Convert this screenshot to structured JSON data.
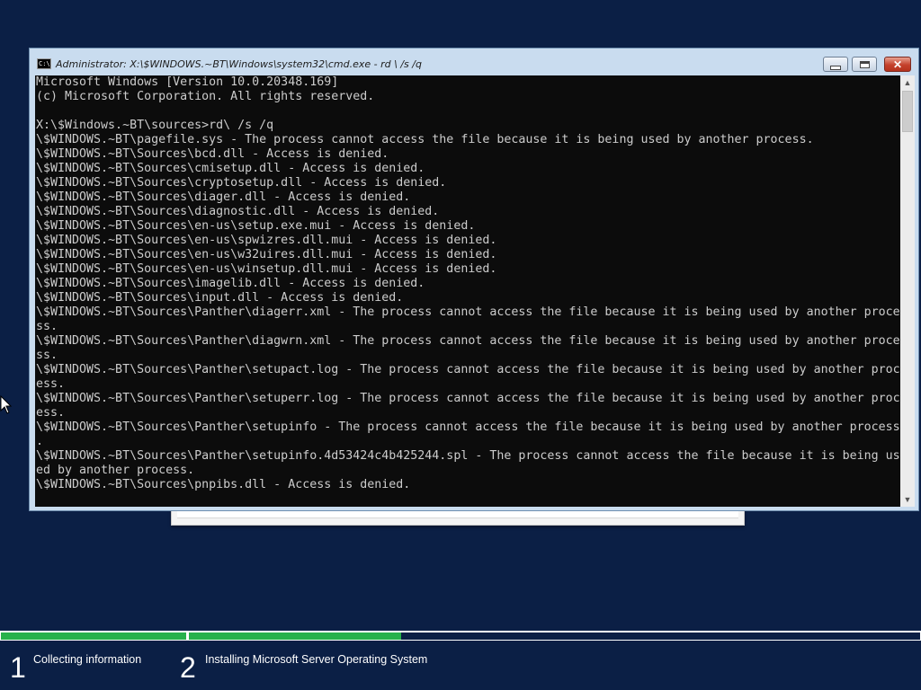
{
  "window": {
    "title": "Administrator: X:\\$WINDOWS.~BT\\Windows\\system32\\cmd.exe - rd \\ /s /q",
    "icon_label": "C:\\",
    "close_glyph": "✕"
  },
  "console": {
    "lines": [
      "Microsoft Windows [Version 10.0.20348.169]",
      "(c) Microsoft Corporation. All rights reserved.",
      "",
      "X:\\$Windows.~BT\\sources>rd\\ /s /q",
      "\\$WINDOWS.~BT\\pagefile.sys - The process cannot access the file because it is being used by another process.",
      "\\$WINDOWS.~BT\\Sources\\bcd.dll - Access is denied.",
      "\\$WINDOWS.~BT\\Sources\\cmisetup.dll - Access is denied.",
      "\\$WINDOWS.~BT\\Sources\\cryptosetup.dll - Access is denied.",
      "\\$WINDOWS.~BT\\Sources\\diager.dll - Access is denied.",
      "\\$WINDOWS.~BT\\Sources\\diagnostic.dll - Access is denied.",
      "\\$WINDOWS.~BT\\Sources\\en-us\\setup.exe.mui - Access is denied.",
      "\\$WINDOWS.~BT\\Sources\\en-us\\spwizres.dll.mui - Access is denied.",
      "\\$WINDOWS.~BT\\Sources\\en-us\\w32uires.dll.mui - Access is denied.",
      "\\$WINDOWS.~BT\\Sources\\en-us\\winsetup.dll.mui - Access is denied.",
      "\\$WINDOWS.~BT\\Sources\\imagelib.dll - Access is denied.",
      "\\$WINDOWS.~BT\\Sources\\input.dll - Access is denied.",
      "\\$WINDOWS.~BT\\Sources\\Panther\\diagerr.xml - The process cannot access the file because it is being used by another proce",
      "ss.",
      "\\$WINDOWS.~BT\\Sources\\Panther\\diagwrn.xml - The process cannot access the file because it is being used by another proce",
      "ss.",
      "\\$WINDOWS.~BT\\Sources\\Panther\\setupact.log - The process cannot access the file because it is being used by another proc",
      "ess.",
      "\\$WINDOWS.~BT\\Sources\\Panther\\setuperr.log - The process cannot access the file because it is being used by another proc",
      "ess.",
      "\\$WINDOWS.~BT\\Sources\\Panther\\setupinfo - The process cannot access the file because it is being used by another process",
      ".",
      "\\$WINDOWS.~BT\\Sources\\Panther\\setupinfo.4d53424c4b425244.spl - The process cannot access the file because it is being us",
      "ed by another process.",
      "\\$WINDOWS.~BT\\Sources\\pnpibs.dll - Access is denied."
    ]
  },
  "setup": {
    "progress": {
      "step1_fraction": 1.0,
      "step2_fraction": 0.29
    },
    "steps": [
      {
        "number": "1",
        "label": "Collecting information"
      },
      {
        "number": "2",
        "label": "Installing Microsoft Server Operating System"
      }
    ]
  },
  "colors": {
    "background": "#0b1f45",
    "progress": "#27b14b",
    "console_bg": "#0c0c0c",
    "console_fg": "#cccccc"
  }
}
